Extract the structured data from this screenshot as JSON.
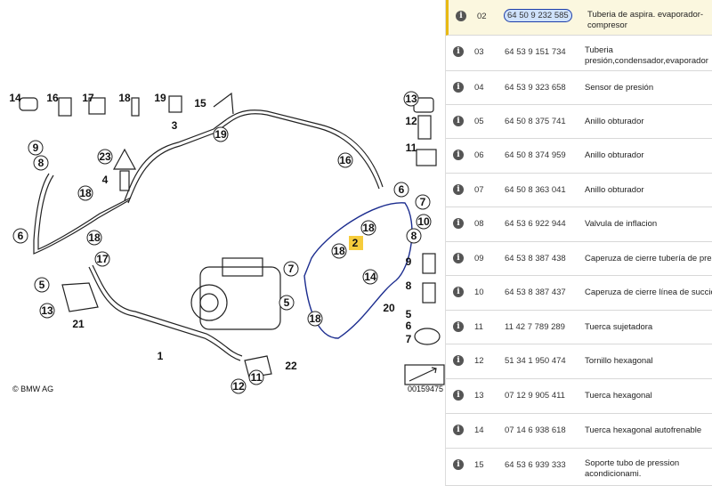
{
  "diagram": {
    "copyright": "© BMW AG",
    "ref_number": "00159475",
    "callouts": [
      "1",
      "2",
      "3",
      "4",
      "5",
      "6",
      "7",
      "8",
      "9",
      "10",
      "11",
      "12",
      "13",
      "14",
      "15",
      "16",
      "17",
      "18",
      "19",
      "20",
      "21",
      "22",
      "23"
    ]
  },
  "parts": [
    {
      "pos": "02",
      "partno": "64 50 9 232 585",
      "desc": "Tuberia de aspira. evaporador-compresor",
      "selected": true
    },
    {
      "pos": "03",
      "partno": "64 53 9 151 734",
      "desc": "Tuberia presión,condensador,evaporador"
    },
    {
      "pos": "04",
      "partno": "64 53 9 323 658",
      "desc": "Sensor de presión"
    },
    {
      "pos": "05",
      "partno": "64 50 8 375 741",
      "desc": "Anillo obturador"
    },
    {
      "pos": "06",
      "partno": "64 50 8 374 959",
      "desc": "Anillo obturador"
    },
    {
      "pos": "07",
      "partno": "64 50 8 363 041",
      "desc": "Anillo obturador"
    },
    {
      "pos": "08",
      "partno": "64 53 6 922 944",
      "desc": "Valvula de inflacion"
    },
    {
      "pos": "09",
      "partno": "64 53 8 387 438",
      "desc": "Caperuza de cierre tubería de presi"
    },
    {
      "pos": "10",
      "partno": "64 53 8 387 437",
      "desc": "Caperuza de cierre línea de succión"
    },
    {
      "pos": "11",
      "partno": "11 42 7 789 289",
      "desc": "Tuerca sujetadora"
    },
    {
      "pos": "12",
      "partno": "51 34 1 950 474",
      "desc": "Tornillo hexagonal"
    },
    {
      "pos": "13",
      "partno": "07 12 9 905 411",
      "desc": "Tuerca hexagonal"
    },
    {
      "pos": "14",
      "partno": "07 14 6 938 618",
      "desc": "Tuerca hexagonal autofrenable"
    },
    {
      "pos": "15",
      "partno": "64 53 6 939 333",
      "desc": "Soporte tubo de pression acondicionami."
    }
  ],
  "info_icon": "info-icon",
  "colors": {
    "highlight": "#e8b913",
    "selection": "#1e3ea8",
    "annotation": "#1c2d8f"
  }
}
